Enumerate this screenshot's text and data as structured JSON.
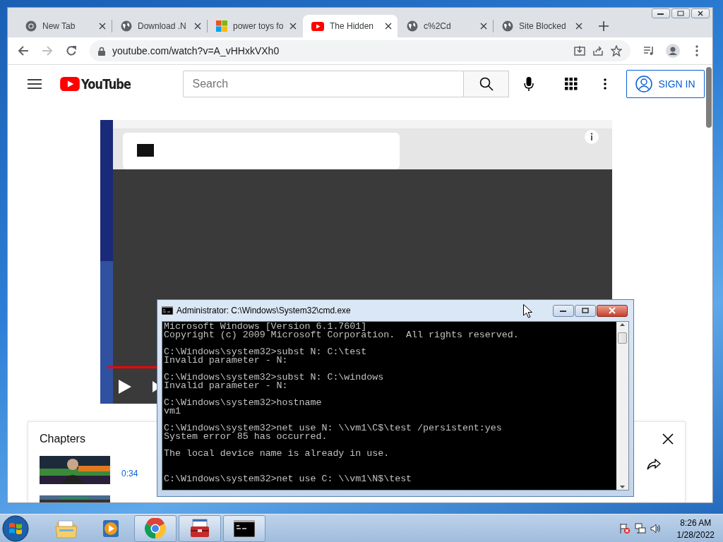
{
  "browser": {
    "tabs": [
      {
        "title": "New Tab",
        "kind": "chrome",
        "selected": false
      },
      {
        "title": "Download .N",
        "kind": "globe",
        "selected": false
      },
      {
        "title": "power toys fo",
        "kind": "windows",
        "selected": false
      },
      {
        "title": "The Hidden",
        "kind": "youtube",
        "selected": true
      },
      {
        "title": "c%2Cd",
        "kind": "globe",
        "selected": false
      },
      {
        "title": "Site Blocked",
        "kind": "globe",
        "selected": false
      }
    ],
    "address_bar": {
      "url": "youtube.com/watch?v=A_vHHxkVXh0"
    }
  },
  "youtube": {
    "logo": "YouTube",
    "search": {
      "placeholder": "Search"
    },
    "sign_in": "SIGN IN",
    "chapters": {
      "title": "Chapters",
      "items": [
        {
          "time": "0:34"
        }
      ]
    }
  },
  "cmd_window": {
    "title": "Administrator: C:\\Windows\\System32\\cmd.exe",
    "paragraphs": [
      [
        "Microsoft Windows [Version 6.1.7601]",
        "Copyright (c) 2009 Microsoft Corporation.  All rights reserved."
      ],
      [
        "C:\\Windows\\system32>subst N: C:\\test",
        "Invalid parameter - N:"
      ],
      [
        "C:\\Windows\\system32>subst N: C:\\windows",
        "Invalid parameter - N:"
      ],
      [
        "C:\\Windows\\system32>hostname",
        "vm1"
      ],
      [
        "C:\\Windows\\system32>net use N: \\\\vm1\\C$\\test /persistent:yes",
        "System error 85 has occurred."
      ],
      [
        "The local device name is already in use."
      ],
      [
        "C:\\Windows\\system32>net use C: \\\\vm1\\N$\\test"
      ]
    ]
  },
  "taskbar": {
    "apps": [
      {
        "kind": "explorer",
        "running": false
      },
      {
        "kind": "media",
        "running": false
      },
      {
        "kind": "chrome",
        "running": true
      },
      {
        "kind": "toolbox",
        "running": true
      },
      {
        "kind": "cmd",
        "running": true
      }
    ],
    "clock": {
      "time": "8:26 AM",
      "date": "1/28/2022"
    }
  }
}
